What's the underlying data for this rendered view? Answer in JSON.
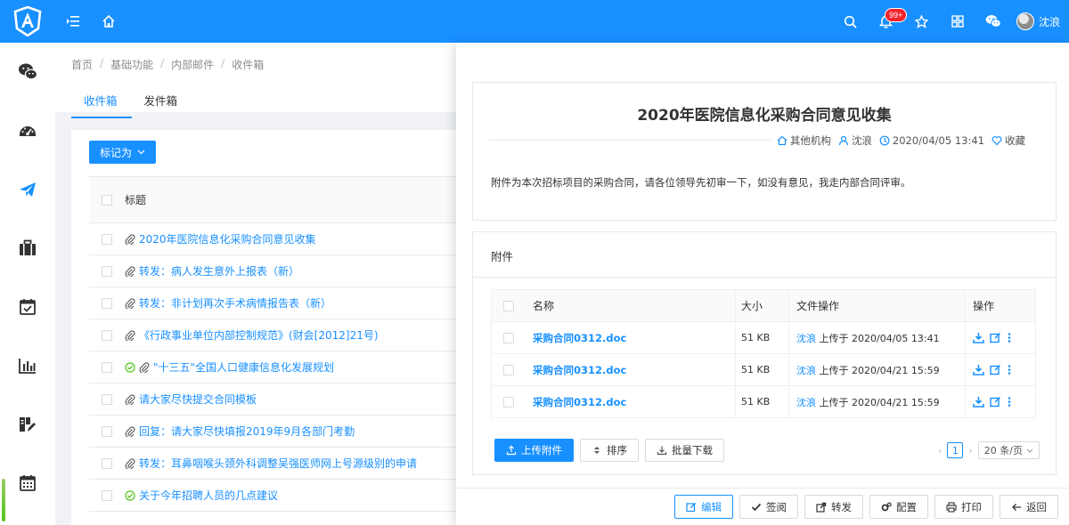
{
  "header": {
    "notification_count": "99+",
    "user_name": "沈浪"
  },
  "breadcrumb": [
    "首页",
    "基础功能",
    "内部邮件",
    "收件箱"
  ],
  "tabs": [
    "收件箱",
    "发件箱"
  ],
  "list": {
    "mark_button": "标记为",
    "column_title": "标题",
    "rows": [
      {
        "title": "2020年医院信息化采购合同意见收集",
        "icon": "paperclip"
      },
      {
        "title": "转发：病人发生意外上报表（新）",
        "icon": "paperclip"
      },
      {
        "title": "转发：非计划再次手术病情报告表（新）",
        "icon": "paperclip"
      },
      {
        "title": "《行政事业单位内部控制规范》(财会[2012]21号)",
        "icon": "paperclip"
      },
      {
        "title": "\"十三五\"全国人口健康信息化发展规划",
        "icon": "check-paperclip"
      },
      {
        "title": "请大家尽快提交合同模板",
        "icon": "paperclip"
      },
      {
        "title": "回复：请大家尽快填报2019年9月各部门考勤",
        "icon": "paperclip"
      },
      {
        "title": "转发：耳鼻咽喉头颈外科调整吴强医师网上号源级别的申请",
        "icon": "paperclip"
      },
      {
        "title": "关于今年招聘人员的几点建议",
        "icon": "check"
      }
    ]
  },
  "detail": {
    "title": "2020年医院信息化采购合同意见收集",
    "org": "其他机构",
    "sender": "沈浪",
    "datetime": "2020/04/05 13:41",
    "favorite": "收藏",
    "content": "附件为本次招标项目的采购合同，请各位领导先初审一下，如没有意见，我走内部合同评审。",
    "attachments_title": "附件",
    "att_columns": {
      "name": "名称",
      "size": "大小",
      "file_op": "文件操作",
      "action": "操作"
    },
    "attachments": [
      {
        "name": "采购合同0312.doc",
        "size": "51 KB",
        "uploader": "沈浪",
        "op": "上传于 2020/04/05 13:41"
      },
      {
        "name": "采购合同0312.doc",
        "size": "51 KB",
        "uploader": "沈浪",
        "op": "上传于 2020/04/21 15:59"
      },
      {
        "name": "采购合同0312.doc",
        "size": "51 KB",
        "uploader": "沈浪",
        "op": "上传于 2020/04/21 15:59"
      }
    ],
    "upload_button": "上传附件",
    "sort_button": "排序",
    "batch_download_button": "批量下载",
    "page_number": "1",
    "page_size": "20 条/页"
  },
  "footer_buttons": {
    "edit": "编辑",
    "sign": "签阅",
    "forward": "转发",
    "config": "配置",
    "print": "打印",
    "back": "返回"
  },
  "colors": {
    "primary": "#1890ff",
    "success": "#52c41a",
    "badge": "#f5222d"
  }
}
